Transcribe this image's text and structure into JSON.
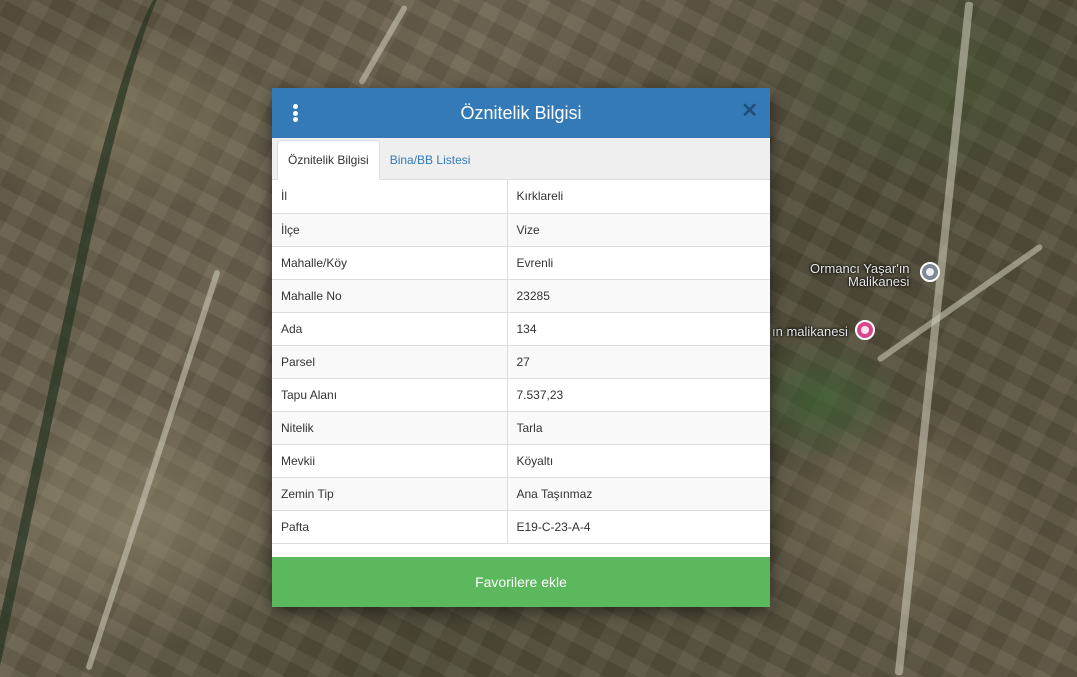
{
  "map": {
    "labels": {
      "place_1_line1": "Ormancı Yaşar'ın",
      "place_1_line2": "Malikanesi",
      "place_2": "ın malikanesi"
    }
  },
  "dialog": {
    "title": "Öznitelik Bilgisi",
    "close_symbol": "✕",
    "tabs": [
      {
        "label": "Öznitelik Bilgisi",
        "active": true
      },
      {
        "label": "Bina/BB Listesi",
        "active": false
      }
    ],
    "rows": [
      {
        "key": "İl",
        "value": "Kırklareli"
      },
      {
        "key": "İlçe",
        "value": "Vize"
      },
      {
        "key": "Mahalle/Köy",
        "value": "Evrenli"
      },
      {
        "key": "Mahalle No",
        "value": "23285"
      },
      {
        "key": "Ada",
        "value": "134"
      },
      {
        "key": "Parsel",
        "value": "27"
      },
      {
        "key": "Tapu Alanı",
        "value": "7.537,23"
      },
      {
        "key": "Nitelik",
        "value": "Tarla"
      },
      {
        "key": "Mevkii",
        "value": "Köyaltı"
      },
      {
        "key": "Zemin Tip",
        "value": "Ana Taşınmaz"
      },
      {
        "key": "Pafta",
        "value": "E19-C-23-A-4"
      }
    ],
    "favorite_button": "Favorilere ekle"
  },
  "colors": {
    "header": "#337ab7",
    "button": "#5cb85c"
  },
  "icons": {
    "menu": "vertical-dots-icon",
    "close": "close-icon",
    "place_pin": "place-pin-icon",
    "hotel_pin": "hotel-pin-icon"
  }
}
